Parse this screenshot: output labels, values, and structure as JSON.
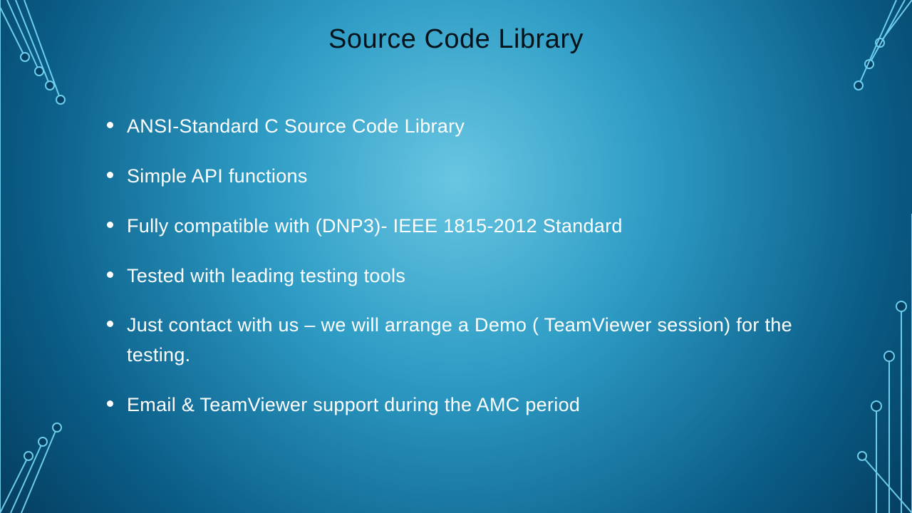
{
  "slide": {
    "title": "Source Code Library",
    "bullets": [
      "ANSI-Standard C Source Code Library",
      "Simple API functions",
      "Fully compatible with (DNP3)- IEEE 1815-2012 Standard",
      "Tested with leading testing tools",
      "Just contact with us – we will arrange a Demo ( TeamViewer session) for the testing.",
      "Email & TeamViewer support during the AMC period"
    ]
  }
}
